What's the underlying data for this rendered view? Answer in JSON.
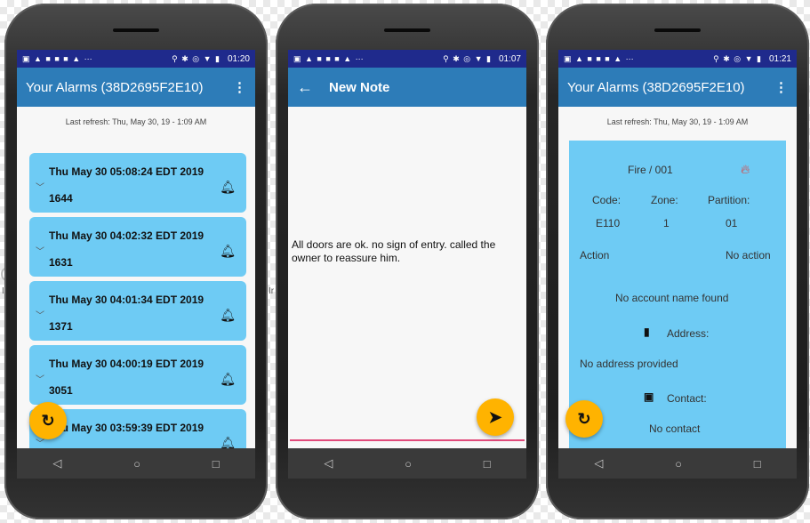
{
  "screen1": {
    "status_time": "01:20",
    "title": "Your Alarms (38D2695F2E10)",
    "menu_icon": "more-vert-icon",
    "refresh_label": "Last refresh: Thu, May 30, 19 - 1:09 AM",
    "alarms": [
      {
        "date": "Thu May 30 05:08:24 EDT 2019",
        "code": "1644"
      },
      {
        "date": "Thu May 30 04:02:32 EDT 2019",
        "code": "1631"
      },
      {
        "date": "Thu May 30 04:01:34 EDT 2019",
        "code": "1371"
      },
      {
        "date": "Thu May 30 04:00:19 EDT 2019",
        "code": "3051"
      },
      {
        "date": "Thu May 30 03:59:39 EDT 2019",
        "code": ""
      }
    ],
    "fab_icon": "refresh-icon"
  },
  "screen2": {
    "status_time": "01:07",
    "title": "New Note",
    "back_icon": "arrow-back-icon",
    "note_text": "All doors are ok. no sign of entry. called the owner to reassure him.",
    "fab_icon": "send-icon"
  },
  "screen3": {
    "status_time": "01:21",
    "title": "Your Alarms (38D2695F2E10)",
    "refresh_label": "Last refresh: Thu, May 30, 19 - 1:09 AM",
    "event": "Fire / 001",
    "code_label": "Code:",
    "code_value": "E110",
    "zone_label": "Zone:",
    "zone_value": "1",
    "partition_label": "Partition:",
    "partition_value": "01",
    "action_label": "Action",
    "action_value": "No action",
    "account": "No account name found",
    "address_label": "Address:",
    "address_value": "No address provided",
    "contact_label": "Contact:",
    "contact_value": "No contact",
    "fab_icon": "refresh-icon"
  },
  "nav": {
    "back": "◁",
    "home": "○",
    "recents": "□"
  },
  "side_letters": {
    "left1": "O",
    "left2": "Ir",
    "mid1": "y",
    "mid2": "Ir",
    "right1": "y"
  },
  "colors": {
    "status_bar": "#1f2a8c",
    "app_bar": "#2d7cb8",
    "card": "#6ecbf4",
    "fab": "#ffb300",
    "accent_line": "#e04a7a"
  }
}
